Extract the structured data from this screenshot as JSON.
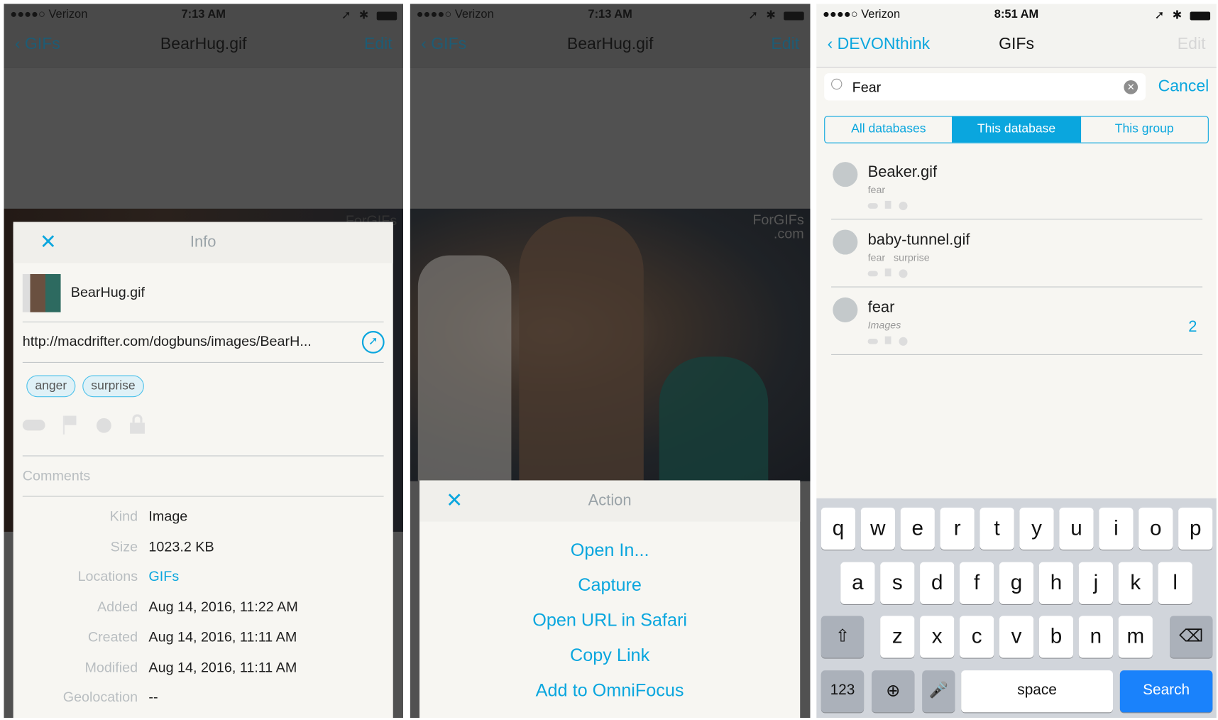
{
  "colors": {
    "accent": "#0aa6de",
    "keyboard_bg": "#d1d5db",
    "search_key": "#1a82fb",
    "sheet_bg": "#f7f6f2"
  },
  "info_screen": {
    "status": {
      "carrier": "●●●●○ Verizon",
      "time": "7:13 AM"
    },
    "nav": {
      "back": "GIFs",
      "title": "BearHug.gif",
      "edit": "Edit"
    },
    "watermark": "ForGIFs",
    "sheet": {
      "close_icon": "close-icon",
      "title": "Info",
      "filename": "BearHug.gif",
      "url": "http://macdrifter.com/dogbuns/images/BearH...",
      "tags": [
        "anger",
        "surprise"
      ],
      "comments_placeholder": "Comments",
      "fields": [
        {
          "label": "Kind",
          "value": "Image"
        },
        {
          "label": "Size",
          "value": "1023.2 KB"
        },
        {
          "label": "Locations",
          "value": "GIFs"
        },
        {
          "label": "Added",
          "value": "Aug 14, 2016, 11:22 AM"
        },
        {
          "label": "Created",
          "value": "Aug 14, 2016, 11:11 AM"
        },
        {
          "label": "Modified",
          "value": "Aug 14, 2016, 11:11 AM"
        },
        {
          "label": "Geolocation",
          "value": "--"
        }
      ]
    }
  },
  "action_screen": {
    "status": {
      "carrier": "●●●●○ Verizon",
      "time": "7:13 AM"
    },
    "nav": {
      "back": "GIFs",
      "title": "BearHug.gif",
      "edit": "Edit"
    },
    "watermark": "ForGIFs .com",
    "sheet": {
      "title": "Action",
      "actions": [
        "Open In...",
        "Capture",
        "Open URL in Safari",
        "Copy Link",
        "Add to OmniFocus"
      ]
    }
  },
  "search_screen": {
    "status": {
      "carrier": "●●●●○ Verizon",
      "time": "8:51 AM"
    },
    "nav": {
      "back": "DEVONthink",
      "title": "GIFs",
      "edit": "Edit"
    },
    "search": {
      "value": "Fear",
      "cancel": "Cancel"
    },
    "scopes": [
      {
        "label": "All databases",
        "selected": false
      },
      {
        "label": "This database",
        "selected": true
      },
      {
        "label": "This group",
        "selected": false
      }
    ],
    "results": [
      {
        "title": "Beaker.gif",
        "subtitle": "fear",
        "count": ""
      },
      {
        "title": "baby-tunnel.gif",
        "subtitle": "fear   surprise",
        "count": ""
      },
      {
        "title": "fear",
        "subtitle": "Images",
        "count": "2"
      }
    ],
    "keyboard": {
      "row1": [
        "q",
        "w",
        "e",
        "r",
        "t",
        "y",
        "u",
        "i",
        "o",
        "p"
      ],
      "row2": [
        "a",
        "s",
        "d",
        "f",
        "g",
        "h",
        "j",
        "k",
        "l"
      ],
      "row3": [
        "z",
        "x",
        "c",
        "v",
        "b",
        "n",
        "m"
      ],
      "numbers": "123",
      "space": "space",
      "search": "Search"
    }
  }
}
